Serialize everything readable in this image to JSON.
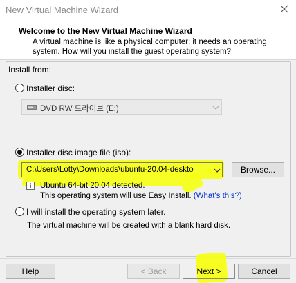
{
  "window": {
    "title": "New Virtual Machine Wizard"
  },
  "header": {
    "title": "Welcome to the New Virtual Machine Wizard",
    "description": "A virtual machine is like a physical computer; it needs an operating system. How will you install the guest operating system?"
  },
  "install_from": {
    "label": "Install from:",
    "options": [
      {
        "label": "Installer disc:",
        "selected": false
      },
      {
        "label": "Installer disc image file (iso):",
        "selected": true
      },
      {
        "label": "I will install the operating system later.",
        "selected": false
      }
    ],
    "disc_drive": {
      "value": "DVD RW 드라이브 (E:)",
      "icon": "disc-drive-icon",
      "enabled": false
    },
    "iso_path": {
      "value": "C:\\Users\\Lotty\\Downloads\\ubuntu-20.04-deskto"
    },
    "browse_label": "Browse...",
    "detected_text": "Ubuntu 64-bit 20.04 detected.",
    "easy_install_text": "This operating system will use Easy Install.",
    "whats_this_link": "(What's this?)",
    "later_description": "The virtual machine will be created with a blank hard disk."
  },
  "buttons": {
    "help": "Help",
    "back": "< Back",
    "next": "Next >",
    "cancel": "Cancel"
  },
  "colors": {
    "highlight": "#f6ff12",
    "link": "#0033cc"
  }
}
